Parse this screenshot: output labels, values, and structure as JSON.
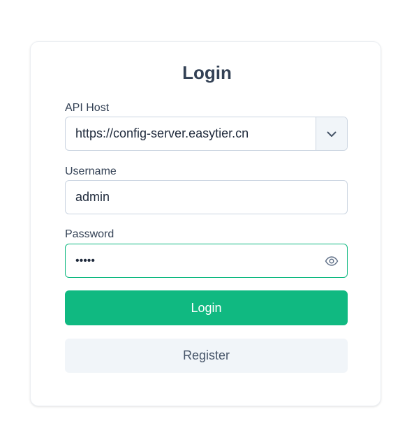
{
  "login": {
    "title": "Login",
    "api_host": {
      "label": "API Host",
      "value": "https://config-server.easytier.cn"
    },
    "username": {
      "label": "Username",
      "value": "admin"
    },
    "password": {
      "label": "Password",
      "masked_value": "•••••"
    },
    "login_button": "Login",
    "register_button": "Register"
  },
  "colors": {
    "accent": "#10b981",
    "text": "#334155",
    "secondary_bg": "#f1f5f9",
    "border": "#cbd5e1"
  },
  "icons": {
    "api_host_dropdown": "chevron-down-icon",
    "password_toggle": "eye-icon"
  }
}
